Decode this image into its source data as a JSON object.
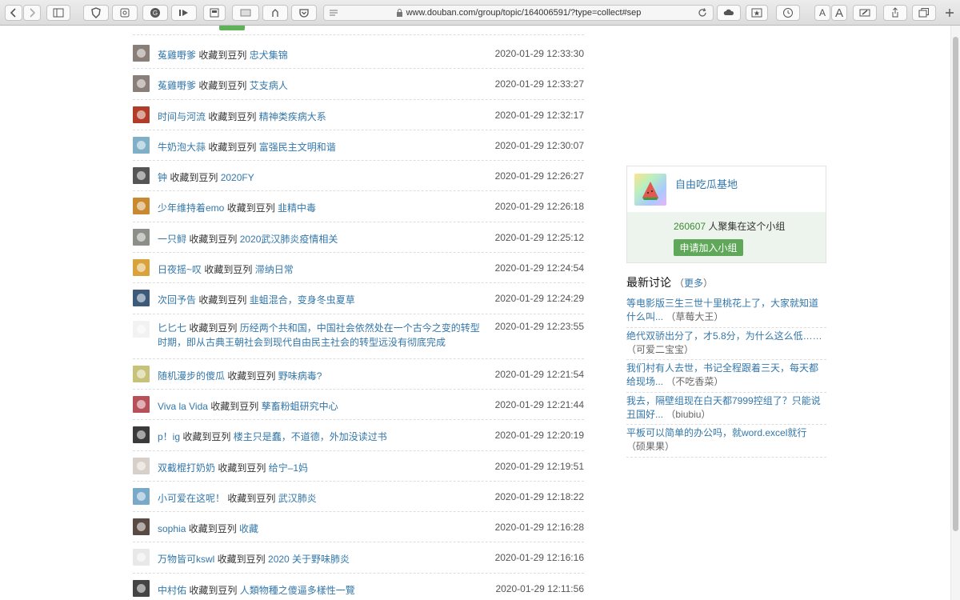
{
  "browser": {
    "url": "www.douban.com/group/topic/164006591/?type=collect#sep",
    "icons": [
      "back-icon",
      "forward-icon",
      "sidebar-icon",
      "shield-icon",
      "screenshot-icon",
      "grammarly-icon",
      "media-icon",
      "reader-icon",
      "window-icon",
      "extension-icon",
      "pocket-icon",
      "lines-icon",
      "reload-icon",
      "cloud-icon",
      "star-icon",
      "clock-icon",
      "text-smaller-icon",
      "text-larger-icon",
      "edit-icon",
      "share-icon",
      "tabs-icon",
      "new-tab-icon"
    ],
    "text_small": "A",
    "text_large": "A"
  },
  "list": {
    "verb": "收藏到豆列",
    "rows": [
      {
        "user": "菟雞嘢爹",
        "doulist": "忠犬集锦",
        "time": "2020-01-29 12:33:30",
        "color": "#8a7f78"
      },
      {
        "user": "菟雞嘢爹",
        "doulist": "艾支病人",
        "time": "2020-01-29 12:33:27",
        "color": "#8a7f78"
      },
      {
        "user": "时间与河流",
        "doulist": "精神类疾病大系",
        "time": "2020-01-29 12:32:17",
        "color": "#b23c2a"
      },
      {
        "user": "牛奶泡大蒜",
        "doulist": "富强民主文明和谐",
        "time": "2020-01-29 12:30:07",
        "color": "#7fb0c8"
      },
      {
        "user": "钟",
        "doulist": "2020FY",
        "time": "2020-01-29 12:26:27",
        "color": "#555555"
      },
      {
        "user": "少年维持着emo",
        "doulist": "韭精中毒",
        "time": "2020-01-29 12:26:18",
        "color": "#c9892f"
      },
      {
        "user": "一只鲟",
        "doulist": "2020武汉肺炎疫情相关",
        "time": "2020-01-29 12:25:12",
        "color": "#8c8f88"
      },
      {
        "user": "日夜摇~叹",
        "doulist": "滞纳日常",
        "time": "2020-01-29 12:24:54",
        "color": "#d9a23a"
      },
      {
        "user": "次回予告",
        "doulist": "韭蛆混合，变身冬虫夏草",
        "time": "2020-01-29 12:24:29",
        "color": "#3d5a7a"
      },
      {
        "user": "匕匕七",
        "doulist": "历经两个共和国，中国社会依然处在一个古今之变的转型时期，即从古典王朝社会到现代自由民主社会的转型远没有彻底完成",
        "time": "2020-01-29 12:23:55",
        "color": "#f2f2f2",
        "tall": true
      },
      {
        "user": "随机漫步的傻瓜",
        "doulist": "野味病毒?",
        "time": "2020-01-29 12:21:54",
        "color": "#c7c27a"
      },
      {
        "user": "Viva la Vida",
        "doulist": "孳畜粉蛆研究中心",
        "time": "2020-01-29 12:21:44",
        "color": "#b8505a"
      },
      {
        "user": "p！ig",
        "doulist": "楼主只是蠢，不道德，外加没读过书",
        "time": "2020-01-29 12:20:19",
        "color": "#3a3a3a"
      },
      {
        "user": "双截棍打奶奶",
        "doulist": "给宁–1妈",
        "time": "2020-01-29 12:19:51",
        "color": "#d8d0c8"
      },
      {
        "user": "小可爱在这呢！",
        "doulist": "武汉肺炎",
        "time": "2020-01-29 12:18:22",
        "color": "#79a9c9"
      },
      {
        "user": "sophia",
        "doulist": "收藏",
        "time": "2020-01-29 12:16:28",
        "color": "#5a4a44"
      },
      {
        "user": "万物皆可kswl",
        "doulist": "2020 关于野味肺炎",
        "time": "2020-01-29 12:16:16",
        "color": "#e8e8e8"
      },
      {
        "user": "中村佑",
        "doulist": "人類物種之傻逼多樣性一覽",
        "time": "2020-01-29 12:11:56",
        "color": "#444444"
      }
    ]
  },
  "group": {
    "name": "自由吃瓜基地",
    "member_count": "260607",
    "member_suffix": " 人聚集在这个小组",
    "join_label": "申请加入小组"
  },
  "latest": {
    "title": "最新讨论",
    "more_open": "（",
    "more_label": "更多",
    "more_close": "）",
    "items": [
      {
        "title": "等电影版三生三世十里桃花上了，大家就知道什么叫...",
        "author": "（草莓大王）"
      },
      {
        "title": "绝代双骄出分了，才5.8分，为什么这么低……",
        "author": "（可爱二宝宝）"
      },
      {
        "title": "我们村有人去世，书记全程跟着三天，每天都给现场...",
        "author": "（不吃香菜）"
      },
      {
        "title": "我去，隔壁组现在白天都7999控组了？只能说丑国好...",
        "author": "（biubiu）"
      },
      {
        "title": "平板可以简单的办公吗，就word.excel就行",
        "author": "（硕果果）"
      }
    ]
  },
  "colors": {
    "link": "#3377aa",
    "green": "#5fa85a",
    "card_bg": "#edf4ed"
  }
}
